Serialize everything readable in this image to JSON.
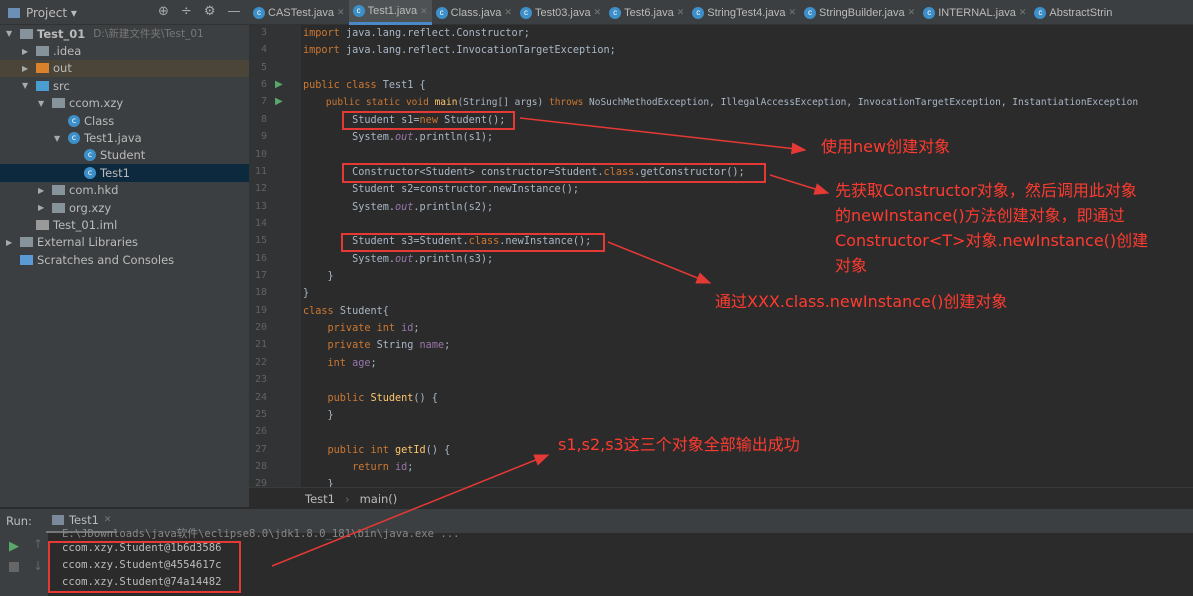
{
  "project_header": {
    "label": "Project ▾"
  },
  "tabs": [
    {
      "label": "CASTest.java"
    },
    {
      "label": "Test1.java",
      "active": true
    },
    {
      "label": "Class.java"
    },
    {
      "label": "Test03.java"
    },
    {
      "label": "Test6.java"
    },
    {
      "label": "StringTest4.java"
    },
    {
      "label": "StringBuilder.java"
    },
    {
      "label": "INTERNAL.java"
    },
    {
      "label": "AbstractStrin"
    }
  ],
  "tree": [
    {
      "label": "Test_01",
      "path": "D:\\新建文件夹\\Test_01",
      "indent": 0,
      "arrow": "▼",
      "type": "module"
    },
    {
      "label": ".idea",
      "indent": 1,
      "arrow": "▶",
      "type": "folder"
    },
    {
      "label": "out",
      "indent": 1,
      "arrow": "▶",
      "type": "folder-orange",
      "hl": true
    },
    {
      "label": "src",
      "indent": 1,
      "arrow": "▼",
      "type": "folder-blue"
    },
    {
      "label": "ccom.xzy",
      "indent": 2,
      "arrow": "▼",
      "type": "package"
    },
    {
      "label": "Class",
      "indent": 3,
      "arrow": "",
      "type": "class"
    },
    {
      "label": "Test1.java",
      "indent": 3,
      "arrow": "▼",
      "type": "class"
    },
    {
      "label": "Student",
      "indent": 4,
      "arrow": "",
      "type": "class"
    },
    {
      "label": "Test1",
      "indent": 4,
      "arrow": "",
      "type": "class",
      "selected": true
    },
    {
      "label": "com.hkd",
      "indent": 2,
      "arrow": "▶",
      "type": "package"
    },
    {
      "label": "org.xzy",
      "indent": 2,
      "arrow": "▶",
      "type": "package"
    },
    {
      "label": "Test_01.iml",
      "indent": 1,
      "arrow": "",
      "type": "file"
    },
    {
      "label": "External Libraries",
      "indent": 0,
      "arrow": "▶",
      "type": "lib"
    },
    {
      "label": "Scratches and Consoles",
      "indent": 0,
      "arrow": "",
      "type": "scratch"
    }
  ],
  "code": [
    {
      "n": "3",
      "t": [
        [
          "import ",
          "kw"
        ],
        [
          "java.lang.reflect.Constructor;",
          ""
        ]
      ]
    },
    {
      "n": "4",
      "t": [
        [
          "import ",
          "kw"
        ],
        [
          "java.lang.reflect.InvocationTargetException;",
          ""
        ]
      ]
    },
    {
      "n": "5",
      "t": []
    },
    {
      "n": "6",
      "run": true,
      "t": [
        [
          "public class ",
          "kw"
        ],
        [
          "Test1 {",
          ""
        ]
      ]
    },
    {
      "n": "7",
      "run": true,
      "t": [
        [
          "    public static void ",
          "kw"
        ],
        [
          "main",
          "fn"
        ],
        [
          "(String[] args) ",
          ""
        ],
        [
          "throws ",
          "kw"
        ],
        [
          "NoSuchMethodException, IllegalAccessException, InvocationTargetException, InstantiationException",
          ""
        ]
      ]
    },
    {
      "n": "8",
      "t": [
        [
          "        Student s1=",
          ""
        ],
        [
          "new ",
          "kw"
        ],
        [
          "Student();",
          ""
        ]
      ]
    },
    {
      "n": "9",
      "t": [
        [
          "        System.",
          ""
        ],
        [
          "out",
          "it"
        ],
        [
          ".println(s1);",
          ""
        ]
      ]
    },
    {
      "n": "10",
      "t": []
    },
    {
      "n": "11",
      "t": [
        [
          "        Constructor<Student> constructor=Student.",
          ""
        ],
        [
          "class",
          "kw"
        ],
        [
          ".getConstructor();",
          ""
        ]
      ]
    },
    {
      "n": "12",
      "t": [
        [
          "        Student s2=constructor.newInstance();",
          ""
        ]
      ]
    },
    {
      "n": "13",
      "t": [
        [
          "        System.",
          ""
        ],
        [
          "out",
          "it"
        ],
        [
          ".println(s2);",
          ""
        ]
      ]
    },
    {
      "n": "14",
      "t": []
    },
    {
      "n": "15",
      "t": [
        [
          "        Student s3=Student.",
          ""
        ],
        [
          "class",
          "kw"
        ],
        [
          ".newInstance();",
          ""
        ]
      ]
    },
    {
      "n": "16",
      "t": [
        [
          "        System.",
          ""
        ],
        [
          "out",
          "it"
        ],
        [
          ".println(s3);",
          ""
        ]
      ]
    },
    {
      "n": "17",
      "t": [
        [
          "    }",
          ""
        ]
      ]
    },
    {
      "n": "18",
      "t": [
        [
          "}",
          ""
        ]
      ]
    },
    {
      "n": "19",
      "t": [
        [
          "class ",
          "kw"
        ],
        [
          "Student{",
          ""
        ]
      ]
    },
    {
      "n": "20",
      "t": [
        [
          "    private int ",
          "kw"
        ],
        [
          "id",
          "nm"
        ],
        [
          ";",
          ""
        ]
      ]
    },
    {
      "n": "21",
      "t": [
        [
          "    private ",
          "kw"
        ],
        [
          "String ",
          ""
        ],
        [
          "name",
          "nm"
        ],
        [
          ";",
          ""
        ]
      ]
    },
    {
      "n": "22",
      "t": [
        [
          "    int ",
          "kw"
        ],
        [
          "age",
          "nm"
        ],
        [
          ";",
          ""
        ]
      ]
    },
    {
      "n": "23",
      "t": []
    },
    {
      "n": "24",
      "t": [
        [
          "    public ",
          "kw"
        ],
        [
          "Student",
          "fn"
        ],
        [
          "() {",
          ""
        ]
      ]
    },
    {
      "n": "25",
      "t": [
        [
          "    }",
          ""
        ]
      ]
    },
    {
      "n": "26",
      "t": []
    },
    {
      "n": "27",
      "t": [
        [
          "    public int ",
          "kw"
        ],
        [
          "getId",
          "fn"
        ],
        [
          "() {",
          ""
        ]
      ]
    },
    {
      "n": "28",
      "t": [
        [
          "        return ",
          "kw"
        ],
        [
          "id",
          "nm"
        ],
        [
          ";",
          ""
        ]
      ]
    },
    {
      "n": "29",
      "t": [
        [
          "    }",
          ""
        ]
      ]
    }
  ],
  "breadcrumb": [
    "Test1",
    "main()"
  ],
  "run": {
    "label": "Run:",
    "tab": "Test1",
    "cmd": "E:\\JDownloads\\java软件\\eclipse8.0\\jdk1.8.0_181\\bin\\java.exe ...",
    "output": [
      "ccom.xzy.Student@1b6d3586",
      "ccom.xzy.Student@4554617c",
      "ccom.xzy.Student@74a14482"
    ]
  },
  "annotations": {
    "note1": "使用new创建对象",
    "note2": [
      "先获取Constructor对象，然后调用此对象",
      "的newInstance()方法创建对象，即通过",
      "Constructor<T>对象.newInstance()创建",
      "对象"
    ],
    "note3": "通过XXX.class.newInstance()创建对象",
    "note4": "s1,s2,s3这三个对象全部输出成功",
    "color": "#e53935"
  }
}
